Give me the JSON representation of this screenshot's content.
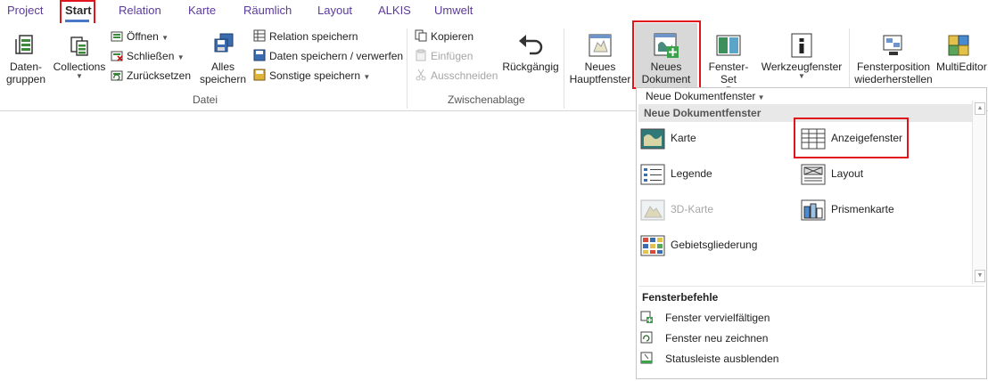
{
  "tabs": [
    "Project",
    "Start",
    "Relation",
    "Karte",
    "Räumlich",
    "Layout",
    "ALKIS",
    "Umwelt"
  ],
  "active_tab": "Start",
  "ribbon": {
    "datei": {
      "group_label": "Datei",
      "datengruppen": [
        "Daten-",
        "gruppen"
      ],
      "collections": "Collections",
      "oeffnen": "Öffnen",
      "schliessen": "Schließen",
      "zuruecksetzen": "Zurücksetzen",
      "alles_speichern": [
        "Alles",
        "speichern"
      ],
      "relation_speichern": "Relation speichern",
      "daten_speichern": "Daten speichern / verwerfen",
      "sonstige_speichern": "Sonstige speichern"
    },
    "zwischenablage": {
      "group_label": "Zwischenablage",
      "kopieren": "Kopieren",
      "einfuegen": "Einfügen",
      "ausschneiden": "Ausschneiden",
      "rueckgaengig": "Rückgängig"
    },
    "fenster": {
      "neues_hauptfenster": [
        "Neues",
        "Hauptfenster"
      ],
      "neues_dokument": [
        "Neues",
        "Dokument"
      ],
      "fenster_set": "Fenster-Set",
      "werkzeugfenster": "Werkzeugfenster",
      "fensterposition": [
        "Fensterposition",
        "wiederherstellen"
      ],
      "multieditor": "MultiEditor"
    }
  },
  "dropdown": {
    "header": "Neue Dokumentfenster",
    "section_title": "Neue Dokumentfenster",
    "items": [
      "Karte",
      "Anzeigefenster",
      "Legende",
      "Layout",
      "3D-Karte",
      "Prismenkarte",
      "Gebietsgliederung"
    ],
    "commands_title": "Fensterbefehle",
    "commands": [
      "Fenster vervielfältigen",
      "Fenster neu zeichnen",
      "Statusleiste ausblenden"
    ]
  },
  "colors": {
    "highlight": "#e0141b",
    "tab_text": "#5b3a9b",
    "active_underline": "#4a78c8"
  }
}
